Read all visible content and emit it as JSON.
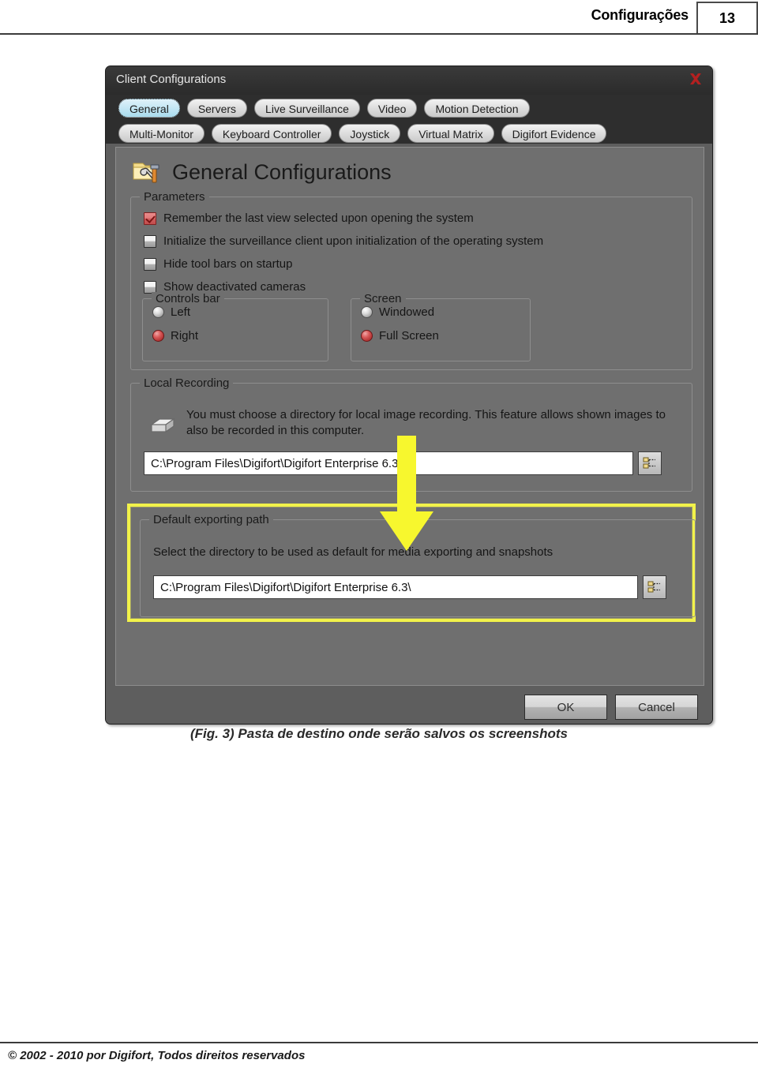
{
  "page": {
    "header_title": "Configurações",
    "page_number": "13",
    "footer_text": "© 2002 - 2010  por Digifort, Todos direitos reservados",
    "figure_caption": "(Fig. 3) Pasta de destino onde serão salvos os screenshots"
  },
  "dialog": {
    "title": "Client Configurations",
    "close_icon": "close-icon",
    "tabs_row1": [
      {
        "label": "General",
        "active": true
      },
      {
        "label": "Servers",
        "active": false
      },
      {
        "label": "Live Surveillance",
        "active": false
      },
      {
        "label": "Video",
        "active": false
      },
      {
        "label": "Motion Detection",
        "active": false
      }
    ],
    "tabs_row2": [
      {
        "label": "Multi-Monitor",
        "active": false
      },
      {
        "label": "Keyboard Controller",
        "active": false
      },
      {
        "label": "Joystick",
        "active": false
      },
      {
        "label": "Virtual Matrix",
        "active": false
      },
      {
        "label": "Digifort Evidence",
        "active": false
      }
    ],
    "panel_title": "General Configurations",
    "panel_icon": "folder-tools-icon",
    "parameters": {
      "legend": "Parameters",
      "checkboxes": [
        {
          "label": "Remember the last view selected upon opening the system",
          "checked": true
        },
        {
          "label": "Initialize the surveillance client upon initialization of the operating system",
          "checked": false
        },
        {
          "label": "Hide tool bars on startup",
          "checked": false
        },
        {
          "label": "Show deactivated cameras",
          "checked": false
        }
      ],
      "controls_bar": {
        "legend": "Controls bar",
        "options": [
          {
            "label": "Left",
            "selected": false
          },
          {
            "label": "Right",
            "selected": true
          }
        ]
      },
      "screen": {
        "legend": "Screen",
        "options": [
          {
            "label": "Windowed",
            "selected": false
          },
          {
            "label": "Full Screen",
            "selected": true
          }
        ]
      }
    },
    "local_recording": {
      "legend": "Local Recording",
      "icon": "disk-drive-icon",
      "description": "You must choose a directory for local image recording. This feature allows shown images to also be recorded in this computer.",
      "path_value": "C:\\Program Files\\Digifort\\Digifort Enterprise 6.3\\",
      "browse_icon": "folder-tree-browse-icon"
    },
    "default_exporting_path": {
      "legend": "Default exporting path",
      "description": "Select the directory to be used as default for media exporting and snapshots",
      "path_value": "C:\\Program Files\\Digifort\\Digifort Enterprise 6.3\\",
      "browse_icon": "folder-tree-browse-icon",
      "highlight_color": "#f2f24a"
    },
    "buttons": {
      "ok": "OK",
      "cancel": "Cancel"
    }
  },
  "annotation": {
    "arrow_color": "#f7f72e",
    "arrow_direction": "down"
  }
}
